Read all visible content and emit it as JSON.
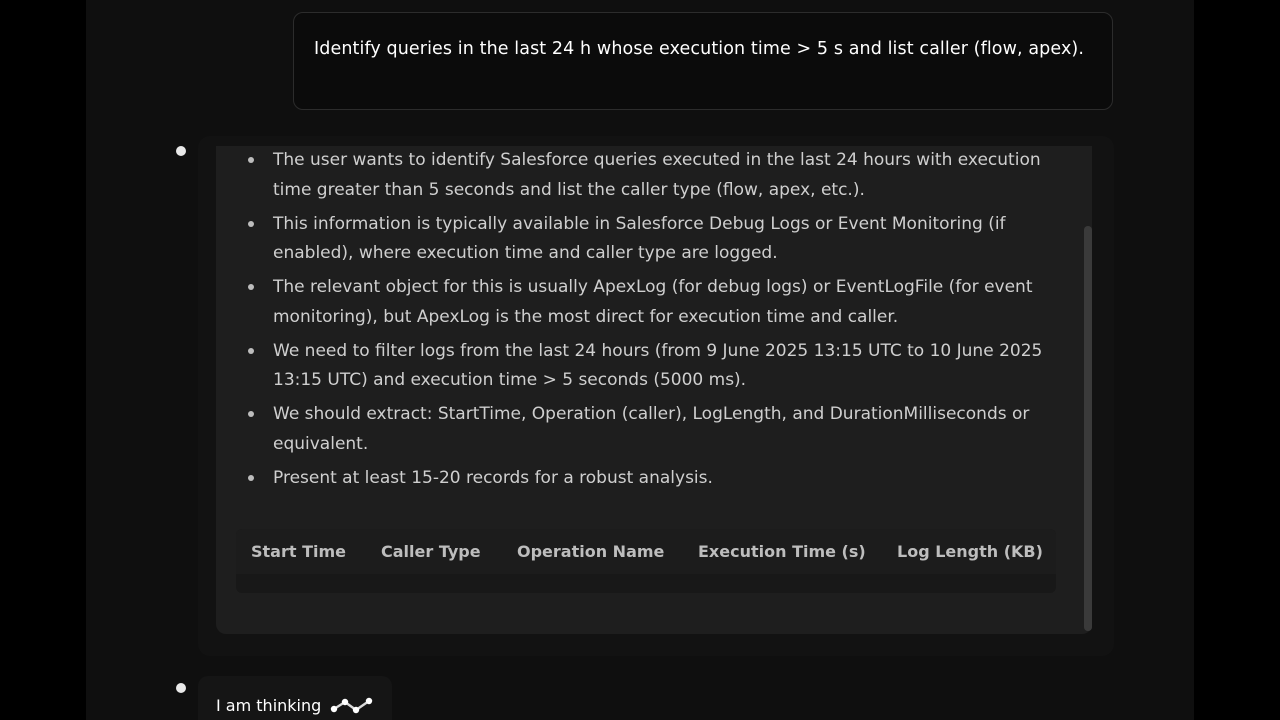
{
  "user_message": {
    "text": "Identify queries in the last 24 h whose execution time > 5 s and list caller (flow, apex)."
  },
  "reasoning": {
    "bullets": [
      "The user wants to identify Salesforce queries executed in the last 24 hours with execution time greater than 5 seconds and list the caller type (flow, apex, etc.).",
      "This information is typically available in Salesforce Debug Logs or Event Monitoring (if enabled), where execution time and caller type are logged.",
      "The relevant object for this is usually ApexLog (for debug logs) or EventLogFile (for event monitoring), but ApexLog is the most direct for execution time and caller.",
      "We need to filter logs from the last 24 hours (from 9 June 2025 13:15 UTC to 10 June 2025 13:15 UTC) and execution time > 5 seconds (5000 ms).",
      "We should extract: StartTime, Operation (caller), LogLength, and DurationMilliseconds or equivalent.",
      "Present at least 15-20 records for a robust analysis."
    ],
    "table": {
      "columns": [
        "Start Time",
        "Caller Type",
        "Operation Name",
        "Execution Time (s)",
        "Log Length (KB)"
      ],
      "rows": []
    }
  },
  "status": {
    "thinking_label": "I am thinking",
    "icon": "thinking-wave-icon"
  },
  "colors": {
    "background": "#000000",
    "panel": "#1e1e1e",
    "text": "#cfcfcf",
    "user_text": "#ffffff"
  }
}
